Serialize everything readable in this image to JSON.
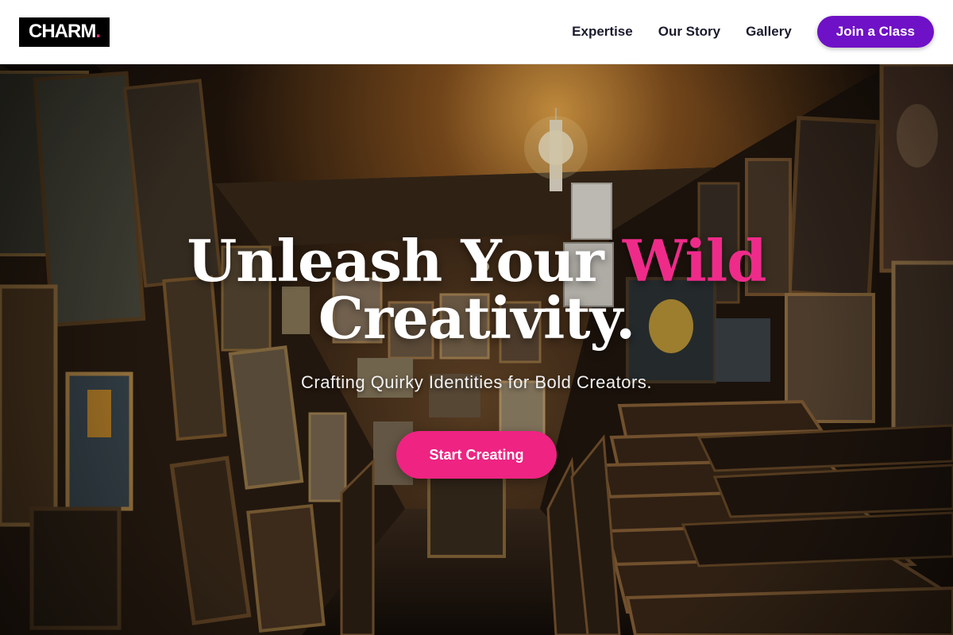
{
  "brand": {
    "name": "CHARM",
    "dot": ".",
    "accent_color": "#e8227d"
  },
  "nav": {
    "links": [
      {
        "label": "Expertise"
      },
      {
        "label": "Our Story"
      },
      {
        "label": "Gallery"
      }
    ],
    "cta_label": "Join a Class",
    "cta_color": "#6f11c6"
  },
  "hero": {
    "title_line1_prefix": "Unleash Your",
    "title_line1_accent": "Wild",
    "title_line2": "Creativity.",
    "subtitle": "Crafting Quirky Identities for Bold Creators.",
    "cta_label": "Start Creating",
    "cta_color": "#ee2382",
    "background_image": "art-studio-gallery-photo"
  }
}
